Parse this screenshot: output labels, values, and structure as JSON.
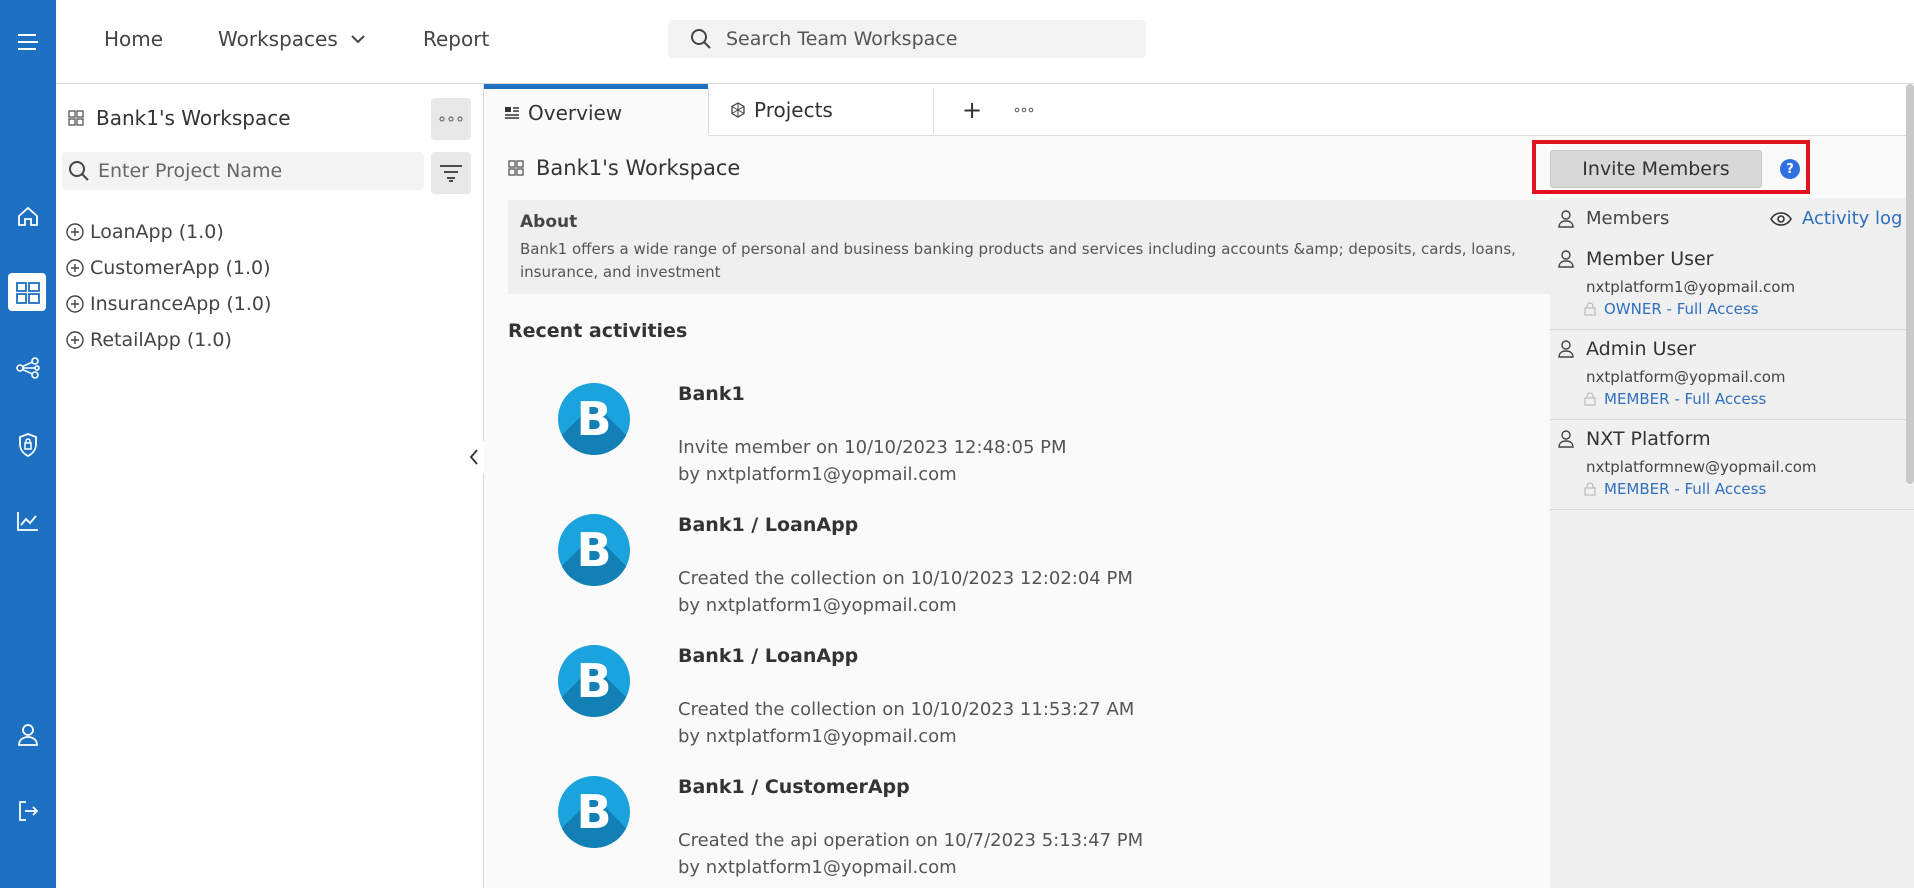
{
  "topnav": {
    "home": "Home",
    "workspaces": "Workspaces",
    "report": "Report",
    "search_placeholder": "Search Team Workspace"
  },
  "sidebar": {
    "title": "Bank1's Workspace",
    "search_placeholder": "Enter Project Name",
    "projects": [
      {
        "label": "LoanApp (1.0)"
      },
      {
        "label": "CustomerApp (1.0)"
      },
      {
        "label": "InsuranceApp (1.0)"
      },
      {
        "label": "RetailApp (1.0)"
      }
    ]
  },
  "tabs": {
    "overview": "Overview",
    "projects": "Projects",
    "add": "+"
  },
  "workspace": {
    "title": "Bank1's Workspace",
    "about_heading": "About",
    "about_text": "Bank1 offers a wide range of personal and business banking products and services including accounts &amp; deposits, cards, loans, insurance, and investment"
  },
  "recent": {
    "heading": "Recent activities",
    "items": [
      {
        "logo": "B",
        "title": "Bank1",
        "description": "Invite member on 10/10/2023 12:48:05 PM",
        "by": "by nxtplatform1@yopmail.com"
      },
      {
        "logo": "B",
        "title": "Bank1 / LoanApp",
        "description": "Created the collection on 10/10/2023 12:02:04 PM",
        "by": "by nxtplatform1@yopmail.com"
      },
      {
        "logo": "B",
        "title": "Bank1 / LoanApp",
        "description": "Created the collection on 10/10/2023 11:53:27 AM",
        "by": "by nxtplatform1@yopmail.com"
      },
      {
        "logo": "B",
        "title": "Bank1 / CustomerApp",
        "description": "Created the api operation on 10/7/2023 5:13:47 PM",
        "by": "by nxtplatform1@yopmail.com"
      }
    ]
  },
  "members": {
    "invite_label": "Invite Members",
    "help": "?",
    "heading": "Members",
    "activity_log": "Activity log",
    "list": [
      {
        "name": "Member User",
        "email": "nxtplatform1@yopmail.com",
        "role": "OWNER - Full Access"
      },
      {
        "name": "Admin User",
        "email": "nxtplatform@yopmail.com",
        "role": "MEMBER - Full Access"
      },
      {
        "name": "NXT Platform",
        "email": "nxtplatformnew@yopmail.com",
        "role": "MEMBER - Full Access"
      }
    ]
  },
  "colors": {
    "rail": "#1d70c2",
    "accent_link": "#2f6fc0",
    "highlight_border": "#e0141e",
    "logo_blue": "#1aa3dc"
  }
}
